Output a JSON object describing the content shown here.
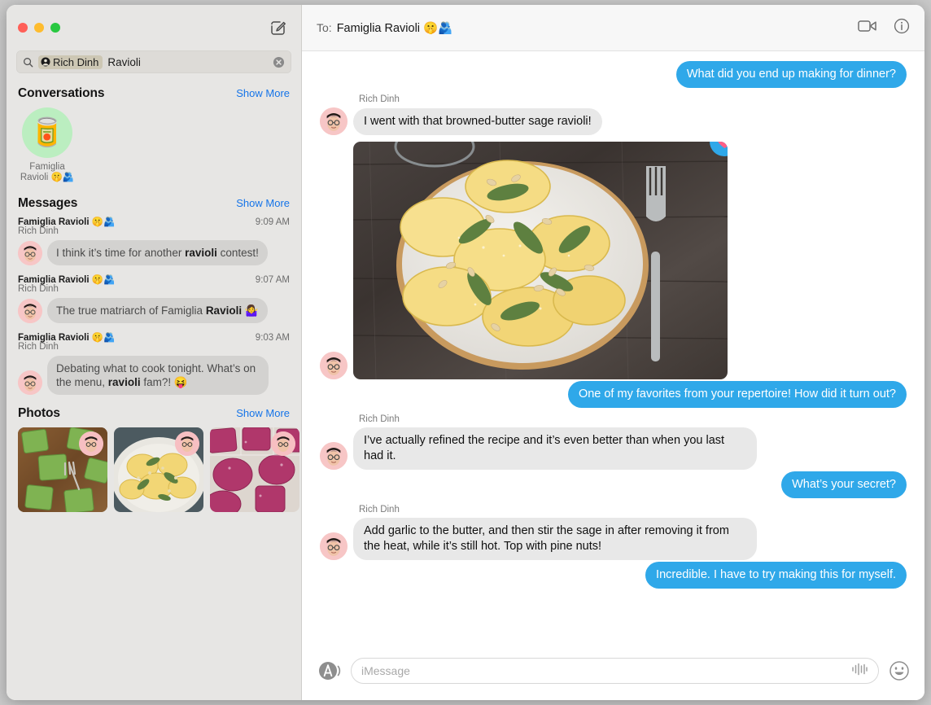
{
  "window": {
    "traffic_lights": [
      "close",
      "minimize",
      "zoom"
    ],
    "compose_icon": "compose-icon"
  },
  "search": {
    "icon": "search-icon",
    "token": {
      "label": "Rich Dinh",
      "icon": "contact-circle-icon"
    },
    "query": "Ravioli",
    "clear_icon": "clear-circle-icon"
  },
  "sidebar": {
    "conversations": {
      "title": "Conversations",
      "show_more": "Show More",
      "items": [
        {
          "avatar_emoji": "🥫",
          "avatar_bg": "#bbeec0",
          "label": "Famiglia Ravioli 🤫🫂"
        }
      ]
    },
    "messages": {
      "title": "Messages",
      "show_more": "Show More",
      "items": [
        {
          "conversation": "Famiglia Ravioli 🤫🫂",
          "sender": "Rich Dinh",
          "time": "9:09 AM",
          "preview_pre": "I think it’s time for another ",
          "preview_match": "ravioli",
          "preview_post": " contest!"
        },
        {
          "conversation": "Famiglia Ravioli 🤫🫂",
          "sender": "Rich Dinh",
          "time": "9:07 AM",
          "preview_pre": "The true matriarch of Famiglia ",
          "preview_match": "Ravioli",
          "preview_post": " 🤷‍♀️"
        },
        {
          "conversation": "Famiglia Ravioli 🤫🫂",
          "sender": "Rich Dinh",
          "time": "9:03 AM",
          "preview_pre": "Debating what to cook tonight. What’s on the menu, ",
          "preview_match": "ravioli",
          "preview_post": " fam?! 😝"
        }
      ]
    },
    "photos": {
      "title": "Photos",
      "show_more": "Show More",
      "items": [
        {
          "description": "green spinach ravioli on wooden board with fork"
        },
        {
          "description": "yellow ravioli with sage on plate"
        },
        {
          "description": "pink beet ravioli dusted with flour"
        }
      ]
    }
  },
  "conversation": {
    "to_label": "To:",
    "title": "Famiglia Ravioli 🤫🫂",
    "facetime_icon": "video-camera-icon",
    "info_icon": "info-circle-icon",
    "messages": [
      {
        "side": "out",
        "text": "What did you end up making for dinner?"
      },
      {
        "side": "in",
        "sender": "Rich Dinh",
        "text": "I went with that browned-butter sage ravioli!"
      },
      {
        "side": "in",
        "type": "image",
        "sender": "",
        "description": "plate of browned-butter sage ravioli with pine nuts on dark wood table with fork",
        "tapback": "heart"
      },
      {
        "side": "out",
        "text": "One of my favorites from your repertoire! How did it turn out?"
      },
      {
        "side": "in",
        "sender": "Rich Dinh",
        "text": "I’ve actually refined the recipe and it’s even better than when you last had it."
      },
      {
        "side": "out",
        "text": "What’s your secret?"
      },
      {
        "side": "in",
        "sender": "Rich Dinh",
        "text": "Add garlic to the butter, and then stir the sage in after removing it from the heat, while it’s still hot. Top with pine nuts!"
      },
      {
        "side": "out",
        "text": "Incredible. I have to try making this for myself."
      }
    ]
  },
  "composer": {
    "app_icon": "app-store-icon",
    "placeholder": "iMessage",
    "value": "",
    "audio_icon": "audio-waveform-icon",
    "emoji_icon": "emoji-smiley-icon"
  },
  "colors": {
    "accent_blue": "#2fa8e9",
    "link_blue": "#1574e8",
    "incoming_bubble": "#e8e8e8",
    "sidebar_bg": "#e7e6e4",
    "tapback_heart": "#ff5f86"
  }
}
